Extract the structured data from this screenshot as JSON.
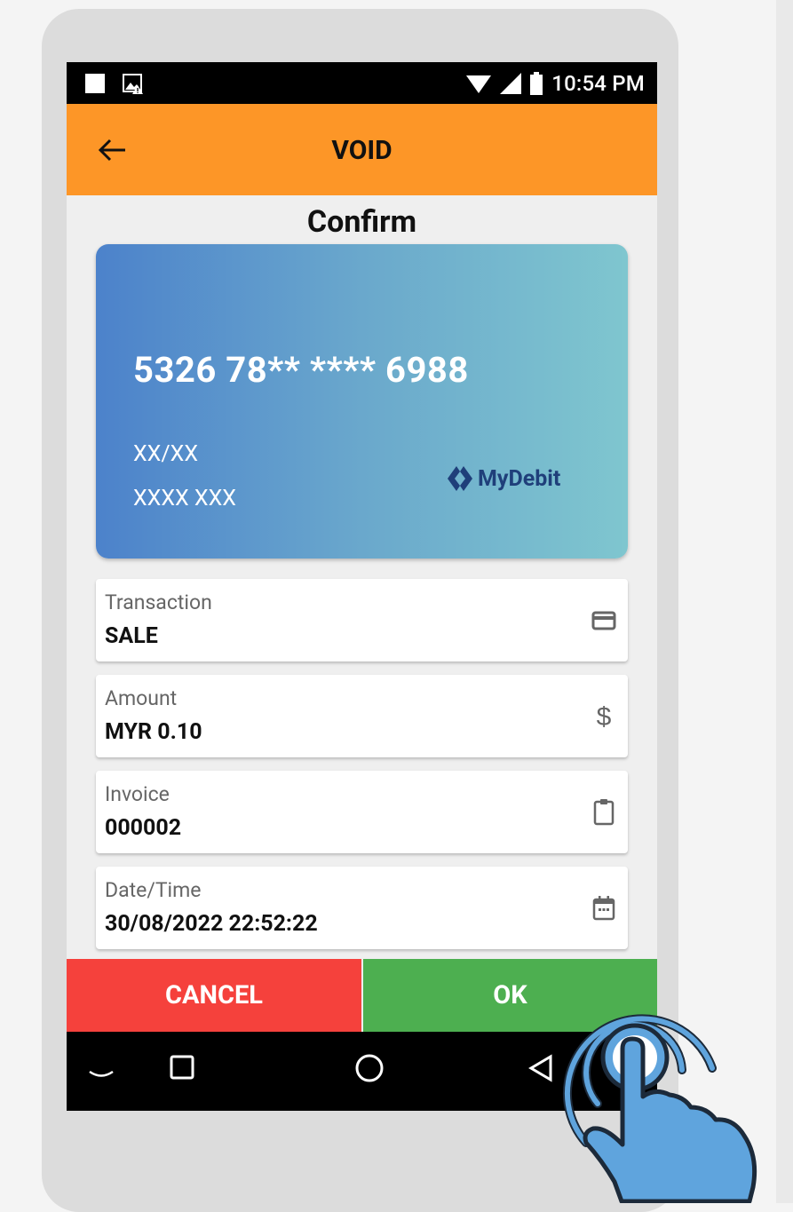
{
  "statusbar": {
    "time": "10:54 PM"
  },
  "appbar": {
    "title": "VOID"
  },
  "page": {
    "heading": "Confirm"
  },
  "card": {
    "number": "5326 78** **** 6988",
    "expiry": "XX/XX",
    "holder": "XXXX XXX",
    "brand": "MyDebit"
  },
  "fields": [
    {
      "label": "Transaction",
      "value": "SALE",
      "icon": "credit-card-icon"
    },
    {
      "label": "Amount",
      "value": "MYR 0.10",
      "icon": "dollar-icon"
    },
    {
      "label": "Invoice",
      "value": "000002",
      "icon": "clipboard-icon"
    },
    {
      "label": "Date/Time",
      "value": "30/08/2022 22:52:22",
      "icon": "calendar-icon"
    }
  ],
  "buttons": {
    "cancel": "CANCEL",
    "ok": "OK"
  },
  "colors": {
    "appbar": "#fd9627",
    "cancel": "#f5413c",
    "ok": "#4daf50",
    "card_start": "#4c82cb",
    "card_end": "#7fc6cf",
    "brand_blue": "#1f3f7a",
    "tap_blue": "#5fa4dd"
  }
}
